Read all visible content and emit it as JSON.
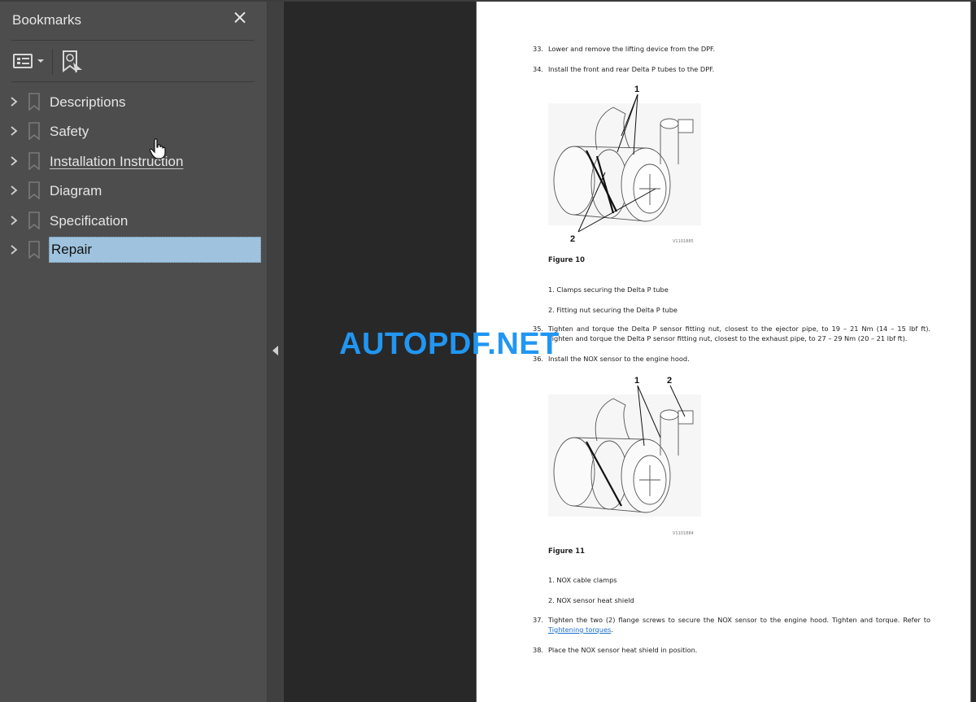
{
  "sidebar": {
    "title": "Bookmarks",
    "close_icon": "close-icon",
    "toolbar": {
      "options_icon": "list-options-icon",
      "find_icon": "find-current-bookmark-icon"
    },
    "items": [
      {
        "label": "Descriptions",
        "expanded": false,
        "state": "normal"
      },
      {
        "label": "Safety",
        "expanded": false,
        "state": "normal"
      },
      {
        "label": "Installation Instruction",
        "expanded": false,
        "state": "hover"
      },
      {
        "label": "Diagram",
        "expanded": false,
        "state": "normal"
      },
      {
        "label": "Specification",
        "expanded": false,
        "state": "normal"
      },
      {
        "label": "Repair",
        "expanded": false,
        "state": "selected"
      }
    ]
  },
  "splitter": {
    "collapse_icon": "collapse-left-icon"
  },
  "watermark": "AUTOPDF.NET",
  "document": {
    "steps": [
      {
        "num": "33.",
        "text": "Lower and remove the lifting device from the DPF."
      },
      {
        "num": "34.",
        "text": "Install the front and rear Delta P tubes to the DPF."
      },
      {
        "num": "35.",
        "text": "Tighten and torque the Delta P sensor fitting nut, closest to the ejector pipe, to 19 – 21 Nm (14 – 15 lbf ft). Tighten and torque the Delta P sensor fitting nut, closest to the exhaust pipe, to 27 – 29 Nm (20 – 21 lbf ft)."
      },
      {
        "num": "36.",
        "text": "Install the NOX sensor to the engine hood."
      },
      {
        "num": "37.",
        "text": "Tighten the two (2) flange screws to secure the NOX sensor to the engine hood. Tighten and torque. Refer to",
        "link": "Tightening torques",
        "after_link": "."
      },
      {
        "num": "38.",
        "text": "Place the NOX sensor heat shield in position."
      }
    ],
    "figures": [
      {
        "caption": "Figure 10",
        "image_id": "V1101885",
        "callouts": [
          "1",
          "2"
        ],
        "legend": [
          "1. Clamps securing the Delta P tube",
          "2. Fitting nut securing the Delta P tube"
        ]
      },
      {
        "caption": "Figure 11",
        "image_id": "V1101884",
        "callouts": [
          "1",
          "2"
        ],
        "legend": [
          "1. NOX cable clamps",
          "2. NOX sensor heat shield"
        ]
      }
    ]
  },
  "colors": {
    "selection": "#9fc3de",
    "watermark": "#2196f3",
    "link": "#1a6fd0"
  }
}
